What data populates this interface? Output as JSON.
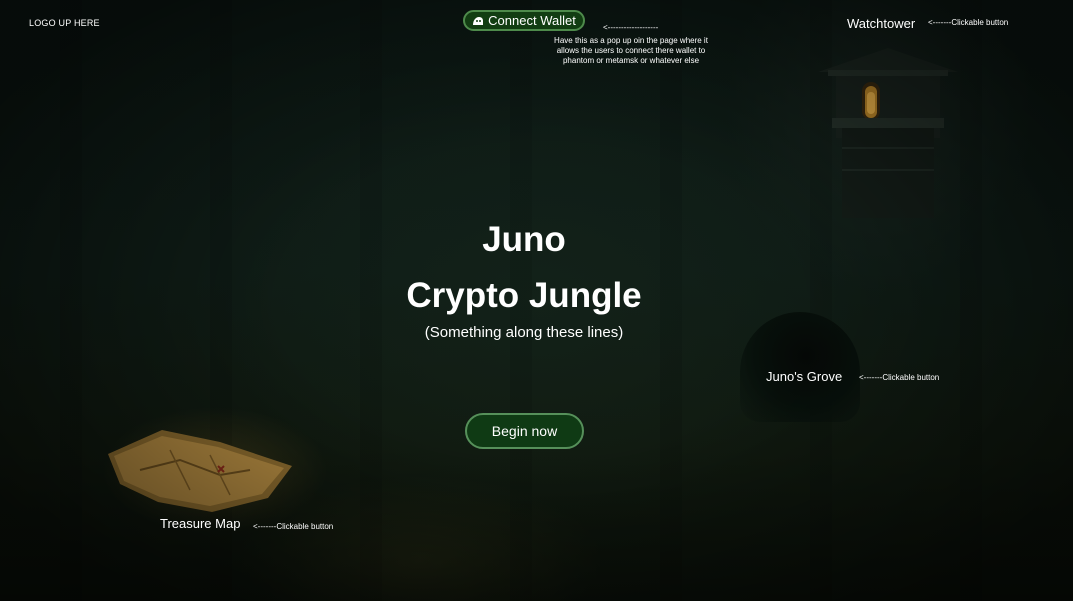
{
  "header": {
    "logo_placeholder": "LOGO UP HERE",
    "connect_wallet": {
      "label": "Connect Wallet",
      "icon": "wallet-icon"
    },
    "connect_wallet_arrow": "<-------------------",
    "connect_wallet_note": "Have this as a pop up  oin the page where it allows the users to connect there wallet to phantom or metamsk or whatever else"
  },
  "nav": {
    "watchtower": {
      "label": "Watchtower",
      "annotation": "<-------Clickable button"
    },
    "junos_grove": {
      "label": "Juno's Grove",
      "annotation": "<-------Clickable button"
    },
    "treasure_map": {
      "label": "Treasure Map",
      "annotation": "<-------Clickable button"
    }
  },
  "hero": {
    "title_line1": "Juno",
    "title_line2": "Crypto Jungle",
    "subtitle": "(Something along these lines)",
    "cta_label": "Begin now"
  },
  "colors": {
    "background": "#0d1a15",
    "button_fill": "#123d12",
    "button_border": "#4e8a4b",
    "text": "#ffffff"
  }
}
